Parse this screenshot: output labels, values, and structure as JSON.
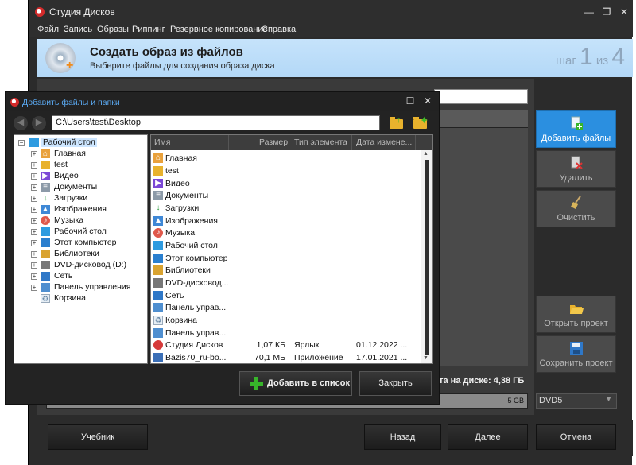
{
  "window": {
    "title": "Студия Дисков",
    "controls": {
      "minimize": "—",
      "restore": "❐",
      "close": "✕"
    }
  },
  "menu": [
    "Файл",
    "Запись",
    "Образы",
    "Риппинг",
    "Резервное копирование",
    "Справка"
  ],
  "header": {
    "title": "Создать образ из файлов",
    "subtitle": "Выберите файлы для создания образа диска",
    "step_prefix": "шаг",
    "step_current": "1",
    "step_sep": "из",
    "step_total": "4"
  },
  "sidebar": {
    "add_files": "Добавить файлы",
    "delete": "Удалить",
    "clear": "Очистить",
    "open_project": "Открыть проект",
    "save_project": "Сохранить проект"
  },
  "status": {
    "disk_space_text": "ста на диске: 4,38 ГБ",
    "progress_mark": "5 GB",
    "disc_type": "DVD5"
  },
  "bottom": {
    "tutorial": "Учебник",
    "back": "Назад",
    "next": "Далее",
    "cancel": "Отмена"
  },
  "dialog": {
    "title": "Добавить файлы и папки",
    "path": "C:\\Users\\test\\Desktop",
    "tree": [
      {
        "label": "Рабочий стол",
        "icon": "desktop-icon",
        "selected": true
      },
      {
        "label": "Главная",
        "icon": "home-icon"
      },
      {
        "label": "test",
        "icon": "folder-icon"
      },
      {
        "label": "Видео",
        "icon": "video-icon"
      },
      {
        "label": "Документы",
        "icon": "documents-icon"
      },
      {
        "label": "Загрузки",
        "icon": "downloads-icon"
      },
      {
        "label": "Изображения",
        "icon": "pictures-icon"
      },
      {
        "label": "Музыка",
        "icon": "music-icon"
      },
      {
        "label": "Рабочий стол",
        "icon": "desktop-icon"
      },
      {
        "label": "Этот компьютер",
        "icon": "computer-icon"
      },
      {
        "label": "Библиотеки",
        "icon": "libraries-icon"
      },
      {
        "label": "DVD-дисковод (D:)",
        "icon": "dvd-drive-icon"
      },
      {
        "label": "Сеть",
        "icon": "network-icon"
      },
      {
        "label": "Панель управления",
        "icon": "control-panel-icon"
      },
      {
        "label": "Корзина",
        "icon": "recycle-bin-icon"
      }
    ],
    "columns": {
      "name": "Имя",
      "size": "Размер",
      "type": "Тип элемента",
      "date": "Дата измене..."
    },
    "files": [
      {
        "name": "Главная",
        "size": "",
        "type": "",
        "date": "",
        "icon": "home-icon"
      },
      {
        "name": "test",
        "size": "",
        "type": "",
        "date": "",
        "icon": "folder-icon"
      },
      {
        "name": "Видео",
        "size": "",
        "type": "",
        "date": "",
        "icon": "video-icon"
      },
      {
        "name": "Документы",
        "size": "",
        "type": "",
        "date": "",
        "icon": "documents-icon"
      },
      {
        "name": "Загрузки",
        "size": "",
        "type": "",
        "date": "",
        "icon": "downloads-icon"
      },
      {
        "name": "Изображения",
        "size": "",
        "type": "",
        "date": "",
        "icon": "pictures-icon"
      },
      {
        "name": "Музыка",
        "size": "",
        "type": "",
        "date": "",
        "icon": "music-icon"
      },
      {
        "name": "Рабочий стол",
        "size": "",
        "type": "",
        "date": "",
        "icon": "desktop-icon"
      },
      {
        "name": "Этот компьютер",
        "size": "",
        "type": "",
        "date": "",
        "icon": "computer-icon"
      },
      {
        "name": "Библиотеки",
        "size": "",
        "type": "",
        "date": "",
        "icon": "libraries-icon"
      },
      {
        "name": "DVD-дисковод...",
        "size": "",
        "type": "",
        "date": "",
        "icon": "dvd-drive-icon"
      },
      {
        "name": "Сеть",
        "size": "",
        "type": "",
        "date": "",
        "icon": "network-icon"
      },
      {
        "name": "Панель управ...",
        "size": "",
        "type": "",
        "date": "",
        "icon": "control-panel-icon"
      },
      {
        "name": "Корзина",
        "size": "",
        "type": "",
        "date": "",
        "icon": "recycle-bin-icon"
      },
      {
        "name": "Панель управ...",
        "size": "",
        "type": "",
        "date": "",
        "icon": "control-panel-icon"
      },
      {
        "name": "Студия Дисков",
        "size": "1,07 КБ",
        "type": "Ярлык",
        "date": "01.12.2022 ...",
        "icon": "app-shortcut-icon"
      },
      {
        "name": "Bazis70_ru-bo...",
        "size": "70,1 МБ",
        "type": "Приложение",
        "date": "17.01.2021 ...",
        "icon": "application-icon"
      }
    ],
    "add_to_list": "Добавить в список",
    "close": "Закрыть",
    "controls": {
      "maximize": "☐",
      "close": "✕"
    }
  },
  "colors": {
    "accent": "#2b8fe0",
    "header_band": "#c6e3fb",
    "window_bg": "#2b2b2b",
    "dialog_title": "#5aa8f0",
    "plus_green": "#37b52a"
  }
}
